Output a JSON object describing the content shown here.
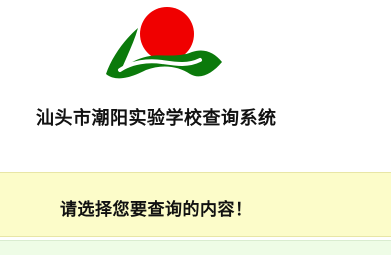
{
  "header": {
    "logo_icon": "school-logo-icon",
    "title": "汕头市潮阳实验学校查询系统"
  },
  "notice": {
    "text": "请选择您要查询的内容！"
  },
  "colors": {
    "logo_red": "#f00000",
    "logo_green": "#0b7a0b",
    "notice_background": "#fcfcc9",
    "content_background": "#eefce6"
  }
}
